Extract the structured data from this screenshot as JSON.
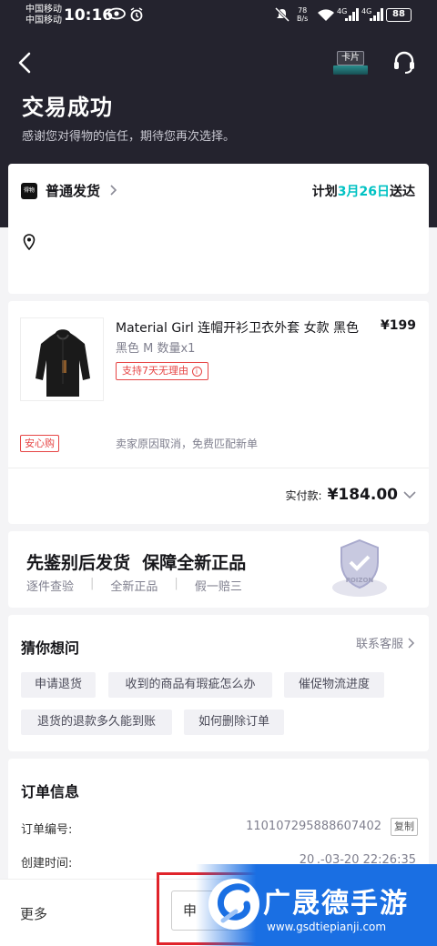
{
  "status_bar": {
    "carrier1": "中国移动",
    "carrier2": "中国移动",
    "time": "10:16",
    "net_speed": "78",
    "net_unit": "B/s",
    "sig1": "4G",
    "sig2": "4G",
    "battery": "88"
  },
  "header": {
    "card_label": "卡片",
    "title": "交易成功",
    "subtitle": "感谢您对得物的信任，期待您再次选择。"
  },
  "delivery": {
    "logo_text": "得物",
    "method": "普通发货",
    "plan_prefix": "计划",
    "plan_date": "3月26日",
    "plan_suffix": "送达"
  },
  "product": {
    "name": "Material Girl 连帽开衫卫衣外套 女款 黑色",
    "price": "¥199",
    "spec": "黑色 M 数量x1",
    "return_badge": "支持7天无理由",
    "safe_badge": "安心购",
    "safe_note": "卖家原因取消，免费匹配新单",
    "paid_label": "实付款:",
    "paid_amount": "¥184.00"
  },
  "promo": {
    "headline": "先鉴别后发货  保障全新正品",
    "item1": "逐件查验",
    "item2": "全新正品",
    "item3": "假一赔三",
    "seal_text": "POIZON"
  },
  "faq": {
    "title": "猜你想问",
    "contact": "联系客服",
    "chips": [
      "申请退货",
      "收到的商品有瑕疵怎么办",
      "催促物流进度",
      "退货的退款多久能到账",
      "如何删除订单"
    ]
  },
  "order": {
    "title": "订单信息",
    "no_label": "订单编号:",
    "no_value": "110107295888607402",
    "copy": "复制",
    "time_label": "创建时间:",
    "time_value": "20 .-03-20 22:26:35"
  },
  "bottom": {
    "more": "更多",
    "btn_partial": "申"
  },
  "watermark": {
    "brand": "广晟德手游",
    "url": "www.gsdtiepianji.com"
  },
  "colors": {
    "header_bg": "#24232e",
    "accent_teal": "#01c2c3",
    "badge_red": "#e64545",
    "brand_blue": "#1f6fe0"
  }
}
